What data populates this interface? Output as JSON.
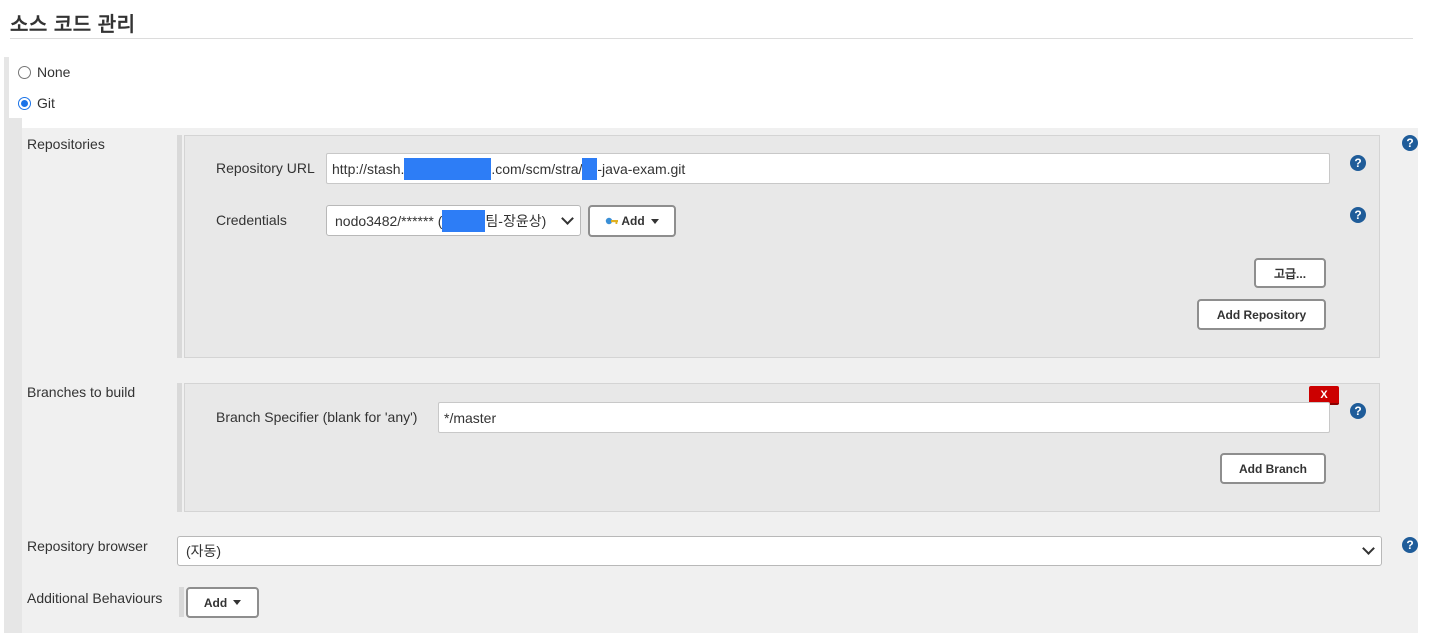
{
  "section": {
    "title": "소스 코드 관리"
  },
  "scm": {
    "options": [
      {
        "label": "None",
        "selected": false
      },
      {
        "label": "Git",
        "selected": true
      }
    ]
  },
  "repositories": {
    "label": "Repositories",
    "url_label": "Repository URL",
    "url_parts": [
      "http://stash.",
      ".com/scm/stra/",
      "-java-exam.git"
    ],
    "credentials_label": "Credentials",
    "credentials_parts": [
      "nodo3482/****** (",
      "팀-장윤상)"
    ],
    "add_label": "Add",
    "advanced_label": "고급...",
    "add_repository_label": "Add Repository"
  },
  "branches": {
    "label": "Branches to build",
    "delete_label": "X",
    "specifier_label": "Branch Specifier (blank for 'any')",
    "specifier_value": "*/master",
    "add_branch_label": "Add Branch"
  },
  "browser": {
    "label": "Repository browser",
    "value": "(자동)"
  },
  "behaviours": {
    "label": "Additional Behaviours",
    "add_label": "Add"
  },
  "help": {
    "symbol": "?"
  },
  "colors": {
    "help": "#1f5c99",
    "delete": "#cc0000",
    "radio": "#1a73e8",
    "redaction": "#2d7df6"
  },
  "icons": {
    "help": "question-circle-icon",
    "key": "key-icon",
    "dropdown": "chevron-down-icon",
    "caret": "caret-down-icon"
  }
}
